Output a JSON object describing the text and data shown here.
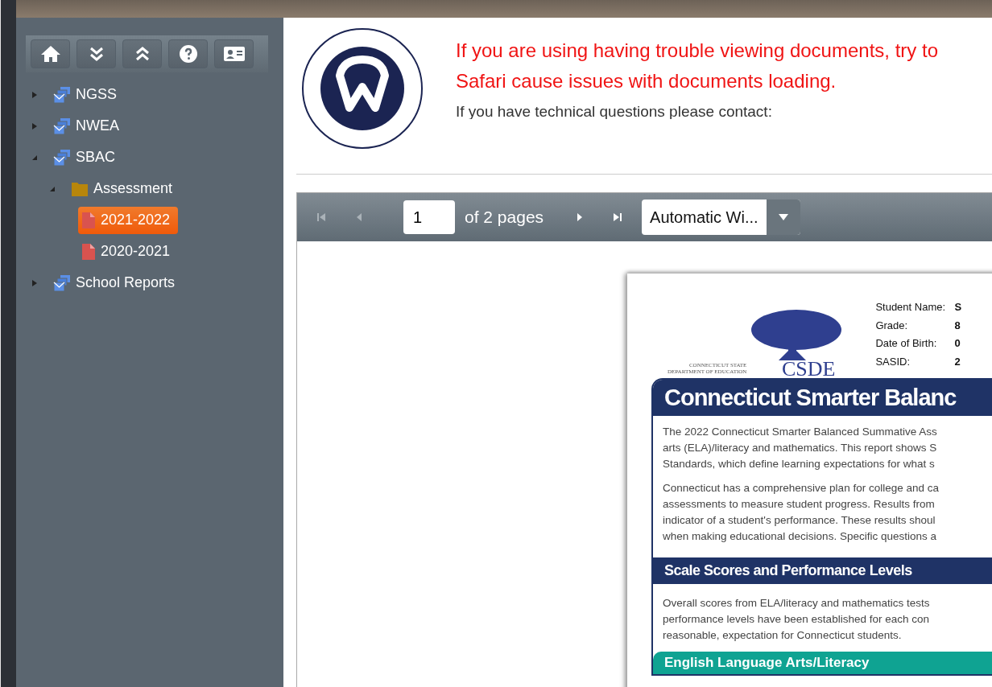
{
  "toolbar": {
    "buttons": [
      {
        "kind": "home"
      },
      {
        "kind": "expand"
      },
      {
        "kind": "collapse"
      },
      {
        "kind": "help"
      },
      {
        "kind": "profile"
      }
    ]
  },
  "tree": [
    {
      "label": "NGSS",
      "kind": "group",
      "expanded": false,
      "selected": false
    },
    {
      "label": "NWEA",
      "kind": "group",
      "expanded": false,
      "selected": false
    },
    {
      "label": "SBAC",
      "kind": "group",
      "expanded": true,
      "selected": false,
      "children": [
        {
          "label": "Assessment",
          "kind": "folder",
          "expanded": true,
          "selected": false,
          "children": [
            {
              "label": "2021-2022",
              "kind": "pdf",
              "selected": true
            },
            {
              "label": "2020-2021",
              "kind": "pdf",
              "selected": false
            }
          ]
        }
      ]
    },
    {
      "label": "School Reports",
      "kind": "group",
      "expanded": false,
      "selected": false
    }
  ],
  "notice": {
    "warning_lines": [
      "If you are using having trouble viewing documents, try to",
      "Safari cause issues with documents loading."
    ],
    "contact": "If you have technical questions please contact:"
  },
  "viewer": {
    "page_value": "1",
    "page_count": "of 2 pages",
    "zoom": "Automatic Wi..."
  },
  "document": {
    "agency_line_1": "CONNECTICUT STATE",
    "agency_line_2": "DEPARTMENT OF EDUCATION",
    "agency_logo": "CSDE",
    "fields": [
      {
        "label": "Student Name:",
        "value": "S"
      },
      {
        "label": "Grade:",
        "value": "8"
      },
      {
        "label": "Date of Birth:",
        "value": "0"
      },
      {
        "label": "SASID:",
        "value": "2"
      }
    ],
    "title": "Connecticut Smarter Balanc",
    "intro": [
      "The 2022 Connecticut Smarter Balanced Summative Ass",
      "arts (ELA)/literacy and mathematics. This report shows S",
      "Standards, which define learning expectations for what s"
    ],
    "plan": [
      "Connecticut has a comprehensive plan for college and ca",
      "assessments to measure student progress. Results from",
      "indicator of a student's performance. These results shoul",
      "when making educational decisions. Specific questions a"
    ],
    "section_heading": "Scale Scores and Performance Levels",
    "section_text": [
      "Overall scores from ELA/literacy and mathematics tests",
      "performance levels have been established for each con",
      "reasonable, expectation for Connecticut students."
    ],
    "subject_heading": "English Language Arts/Literacy"
  }
}
